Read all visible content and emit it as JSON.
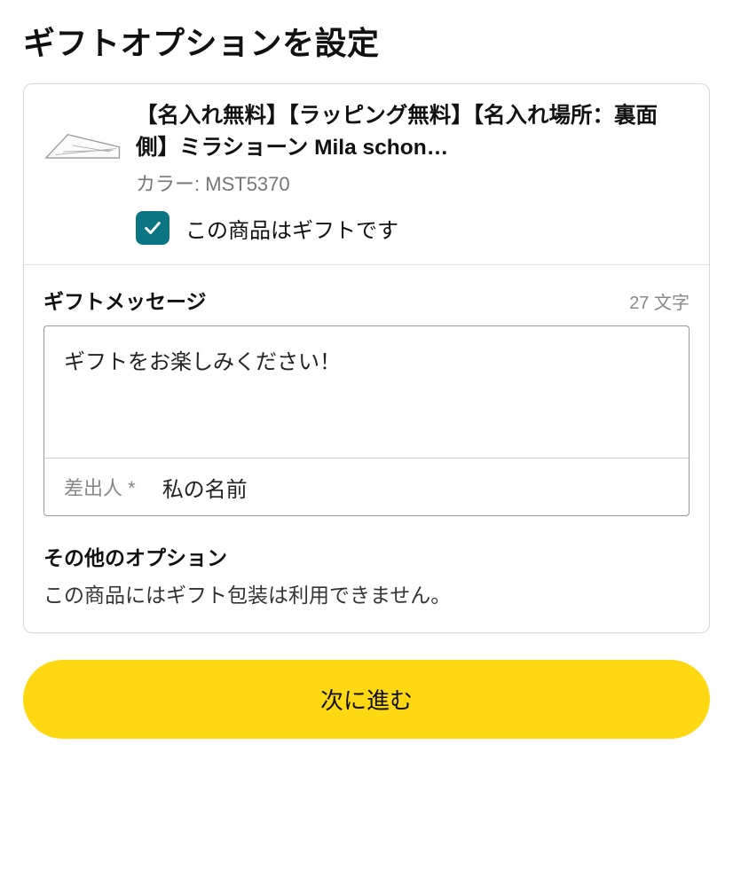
{
  "title": "ギフトオプションを設定",
  "product": {
    "name": "【名入れ無料】【ラッピング無料】【名入れ場所：裏面側】ミラショーン Mila schon…",
    "variant_label": "カラー:",
    "variant_value": "MST5370",
    "gift_checkbox_label": "この商品はギフトです"
  },
  "message": {
    "section_label": "ギフトメッセージ",
    "char_count": "27 文字",
    "value": "ギフトをお楽しみください！",
    "sender_label": "差出人 *",
    "sender_value": "私の名前"
  },
  "other": {
    "label": "その他のオプション",
    "text": "この商品にはギフト包装は利用できません。"
  },
  "button": {
    "next": "次に進む"
  }
}
